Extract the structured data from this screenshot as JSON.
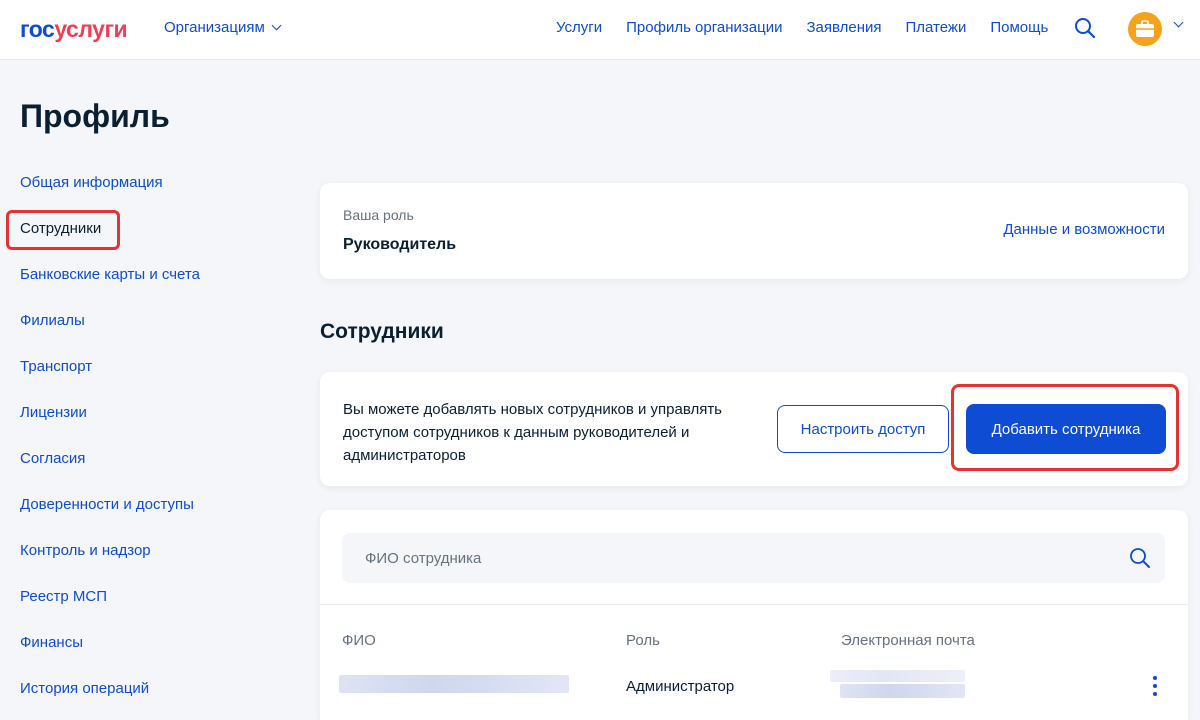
{
  "header": {
    "logo_part1": "гос",
    "logo_part2": "услуги",
    "org_menu_label": "Организациям",
    "nav": [
      {
        "label": "Услуги"
      },
      {
        "label": "Профиль организации"
      },
      {
        "label": "Заявления"
      },
      {
        "label": "Платежи"
      },
      {
        "label": "Помощь"
      }
    ],
    "icons": {
      "search": "search-icon",
      "avatar": "briefcase-icon",
      "menu": "chevron-down-icon"
    }
  },
  "page": {
    "title": "Профиль"
  },
  "sidebar": {
    "items": [
      {
        "label": "Общая информация"
      },
      {
        "label": "Сотрудники"
      },
      {
        "label": "Банковские карты и счета"
      },
      {
        "label": "Филиалы"
      },
      {
        "label": "Транспорт"
      },
      {
        "label": "Лицензии"
      },
      {
        "label": "Согласия"
      },
      {
        "label": "Доверенности и доступы"
      },
      {
        "label": "Контроль и надзор"
      },
      {
        "label": "Реестр МСП"
      },
      {
        "label": "Финансы"
      },
      {
        "label": "История операций"
      }
    ],
    "active_index": 1
  },
  "role_card": {
    "label": "Ваша роль",
    "value": "Руководитель",
    "link": "Данные и возможности"
  },
  "employees": {
    "section_title": "Сотрудники",
    "info_text": "Вы можете добавлять новых сотрудников и управлять доступом сотрудников к данным руководителей и администраторов",
    "btn_configure": "Настроить доступ",
    "btn_add": "Добавить сотрудника",
    "search_placeholder": "ФИО сотрудника",
    "columns": [
      "ФИО",
      "Роль",
      "Электронная почта"
    ],
    "rows": [
      {
        "role": "Администратор"
      }
    ]
  },
  "colors": {
    "brand_blue": "#0d4cd3",
    "brand_red": "#ee3f58",
    "highlight_red": "#e3342f",
    "avatar_orange": "#f7a21b",
    "background": "#f4f6f9"
  }
}
